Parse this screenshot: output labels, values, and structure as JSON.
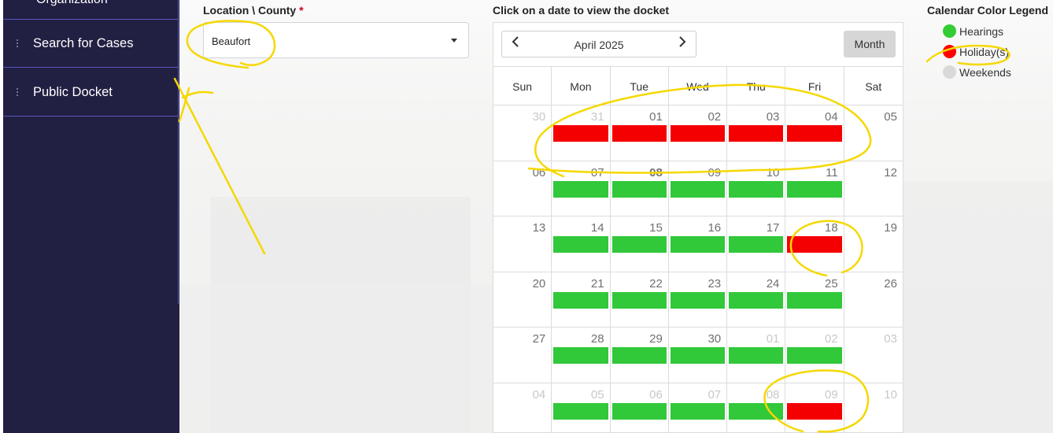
{
  "sidebar": {
    "top_partial": "Organization",
    "items": [
      {
        "label": "Search for Cases"
      },
      {
        "label": "Public Docket"
      }
    ]
  },
  "location": {
    "label": "Location \\ County",
    "required_mark": "*",
    "value": "Beaufort"
  },
  "calendar": {
    "instruction": "Click on a date to view the docket",
    "month_label": "April 2025",
    "prev_icon": "chevron-left-icon",
    "next_icon": "chevron-right-icon",
    "view_button": "Month",
    "weekdays": [
      "Sun",
      "Mon",
      "Tue",
      "Wed",
      "Thu",
      "Fri",
      "Sat"
    ],
    "weeks": [
      [
        {
          "d": "30",
          "o": true
        },
        {
          "d": "31",
          "o": true,
          "s": "holiday"
        },
        {
          "d": "01",
          "s": "holiday"
        },
        {
          "d": "02",
          "s": "holiday"
        },
        {
          "d": "03",
          "s": "holiday"
        },
        {
          "d": "04",
          "s": "holiday"
        },
        {
          "d": "05"
        }
      ],
      [
        {
          "d": "06"
        },
        {
          "d": "07",
          "s": "hearing"
        },
        {
          "d": "08",
          "s": "hearing",
          "b": true
        },
        {
          "d": "09",
          "s": "hearing"
        },
        {
          "d": "10",
          "s": "hearing"
        },
        {
          "d": "11",
          "s": "hearing"
        },
        {
          "d": "12"
        }
      ],
      [
        {
          "d": "13"
        },
        {
          "d": "14",
          "s": "hearing"
        },
        {
          "d": "15",
          "s": "hearing"
        },
        {
          "d": "16",
          "s": "hearing"
        },
        {
          "d": "17",
          "s": "hearing"
        },
        {
          "d": "18",
          "s": "holiday"
        },
        {
          "d": "19"
        }
      ],
      [
        {
          "d": "20"
        },
        {
          "d": "21",
          "s": "hearing"
        },
        {
          "d": "22",
          "s": "hearing"
        },
        {
          "d": "23",
          "s": "hearing"
        },
        {
          "d": "24",
          "s": "hearing"
        },
        {
          "d": "25",
          "s": "hearing"
        },
        {
          "d": "26"
        }
      ],
      [
        {
          "d": "27"
        },
        {
          "d": "28",
          "s": "hearing"
        },
        {
          "d": "29",
          "s": "hearing"
        },
        {
          "d": "30",
          "s": "hearing"
        },
        {
          "d": "01",
          "o": true,
          "s": "hearing"
        },
        {
          "d": "02",
          "o": true,
          "s": "hearing"
        },
        {
          "d": "03",
          "o": true
        }
      ],
      [
        {
          "d": "04",
          "o": true
        },
        {
          "d": "05",
          "o": true,
          "s": "hearing"
        },
        {
          "d": "06",
          "o": true,
          "s": "hearing"
        },
        {
          "d": "07",
          "o": true,
          "s": "hearing"
        },
        {
          "d": "08",
          "o": true,
          "s": "hearing"
        },
        {
          "d": "09",
          "o": true,
          "s": "holiday"
        },
        {
          "d": "10",
          "o": true
        }
      ]
    ]
  },
  "legend": {
    "title": "Calendar Color Legend",
    "items": [
      {
        "label": "Hearings",
        "color": "#33cc33"
      },
      {
        "label": "Holiday(s)",
        "color": "#ff0000"
      },
      {
        "label": "Weekends",
        "color": "#d9d9d9"
      }
    ]
  },
  "colors": {
    "sidebar_bg": "#211f42",
    "hearing": "#31c83a",
    "holiday": "#f50000",
    "annotation": "#f5d800"
  }
}
